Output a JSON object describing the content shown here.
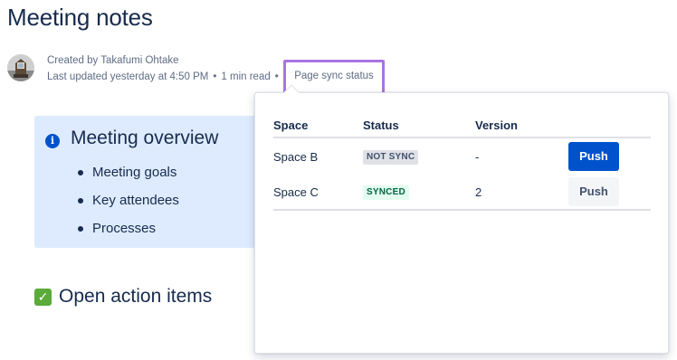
{
  "page": {
    "title": "Meeting notes"
  },
  "byline": {
    "created_by": "Created by Takafumi Ohtake",
    "last_updated": "Last updated yesterday at 4:50 PM",
    "read_time": "1 min read",
    "separator": "•",
    "sync_link": "Page sync status"
  },
  "panel": {
    "title": "Meeting overview",
    "items": [
      "Meeting goals",
      "Key attendees",
      "Processes"
    ]
  },
  "action_heading": "Open action items",
  "sync_popup": {
    "headers": {
      "space": "Space",
      "status": "Status",
      "version": "Version"
    },
    "rows": [
      {
        "space": "Space B",
        "status": "NOT SYNC",
        "version": "-",
        "action": "Push"
      },
      {
        "space": "Space C",
        "status": "SYNCED",
        "version": "2",
        "action": "Push"
      }
    ]
  },
  "colors": {
    "primary": "#0052cc",
    "highlight": "#a874e0",
    "panel_bg": "#deebff",
    "synced": "#006644"
  },
  "icons": {
    "avatar": "user-avatar",
    "info": "info-icon",
    "check": "checkbox-checked-icon"
  }
}
